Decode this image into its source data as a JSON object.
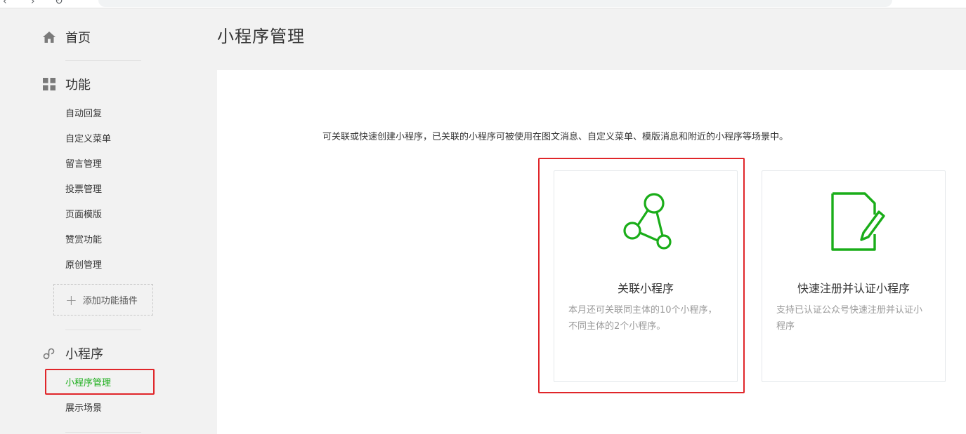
{
  "sidebar": {
    "home": {
      "label": "首页",
      "icon": "home-icon"
    },
    "function": {
      "label": "功能",
      "icon": "grid-icon",
      "items": [
        {
          "label": "自动回复"
        },
        {
          "label": "自定义菜单"
        },
        {
          "label": "留言管理"
        },
        {
          "label": "投票管理"
        },
        {
          "label": "页面模版"
        },
        {
          "label": "赞赏功能"
        },
        {
          "label": "原创管理"
        }
      ],
      "add_plugin_label": "添加功能插件"
    },
    "miniprogram": {
      "label": "小程序",
      "icon": "link-icon",
      "items": [
        {
          "label": "小程序管理",
          "active": true
        },
        {
          "label": "展示场景"
        }
      ]
    }
  },
  "page": {
    "title": "小程序管理",
    "intro": "可关联或快速创建小程序，已关联的小程序可被使用在图文消息、自定义菜单、模版消息和附近的小程序等场景中。"
  },
  "cards": {
    "link": {
      "icon": "network-nodes-icon",
      "title": "关联小程序",
      "desc": "本月还可关联同主体的10个小程序，不同主体的2个小程序。"
    },
    "register": {
      "icon": "document-edit-icon",
      "title": "快速注册并认证小程序",
      "desc": "支持已认证公众号快速注册并认证小程序"
    }
  },
  "colors": {
    "accent": "#1aad19",
    "highlight": "#e0262a",
    "text": "#353535",
    "muted": "#9a9a9a"
  }
}
